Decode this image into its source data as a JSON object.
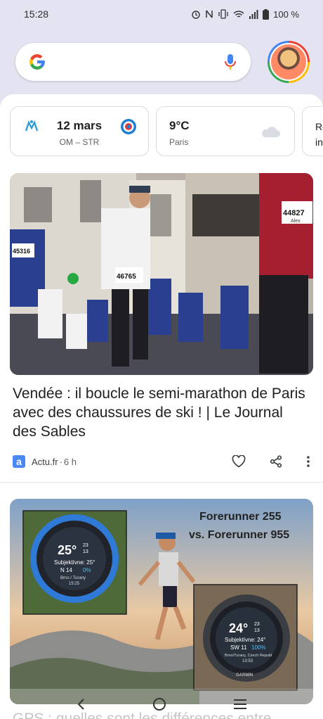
{
  "status": {
    "time": "15:28",
    "battery": "100 %"
  },
  "search": {
    "logo": "google-g-icon",
    "mic": "mic-icon"
  },
  "chips": {
    "match": {
      "date": "12 mars",
      "teams": "OM – STR"
    },
    "weather": {
      "temp": "9°C",
      "city": "Paris"
    },
    "more": {
      "text_line1": "Re",
      "text_line2": "in"
    }
  },
  "articles": [
    {
      "title": "Vendée : il boucle le semi-marathon de Paris avec des chaussures de ski ! | Le Journal des Sables",
      "source_icon": "a",
      "source": "Actu.fr",
      "separator": "·",
      "time": "6 h",
      "bib_numbers": [
        "44827",
        "46765",
        "45316"
      ],
      "bib_name": "Alex"
    },
    {
      "image_caption_line1": "Forerunner 255",
      "image_caption_line2": "vs. Forerunner 955",
      "watch1": {
        "temp": "25°",
        "hi": "23",
        "lo": "13",
        "feels": "Subjektívne: 25°",
        "wind": "N 14",
        "rain": "0%",
        "place": "Brno / Turany",
        "time": "15:25"
      },
      "watch2": {
        "temp": "24°",
        "hi": "23",
        "lo": "13",
        "feels": "Subjektívne: 24°",
        "wind": "SW 11",
        "rain": "100%",
        "place": "Brno/Turany, Czech Republ",
        "time": "13:53",
        "brand": "GARMIN"
      },
      "title": "GPS : quelles sont les différences entre"
    }
  ],
  "colors": {
    "background": "#e4e3f2",
    "accent_blue": "#4285f4",
    "source_blue": "#4a89f3"
  }
}
